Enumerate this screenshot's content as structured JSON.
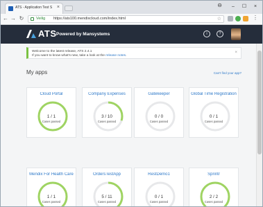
{
  "browser": {
    "tab_title": "ATS - Application Test S",
    "secure_label": "Veilig",
    "url": "https://ats100.mendixcloud.com/index.html"
  },
  "header": {
    "logo_text": "ATS",
    "logo_sub": "Powered by Mansystems"
  },
  "notice": {
    "line1": "Welcome to the latest release, ATS 2.4.1",
    "line2_prefix": "If you want to know what's new, take a look at the ",
    "line2_link": "release notes",
    "line2_suffix": "."
  },
  "main": {
    "title": "My apps",
    "cant_find": "Can't find your app?"
  },
  "apps": [
    {
      "name": "Cloud Portal",
      "count": "1 / 1",
      "sub": "Cases passed",
      "progress": 1.0
    },
    {
      "name": "Company Expenses",
      "count": "3 / 10",
      "sub": "Cases passed",
      "progress": 0.3
    },
    {
      "name": "Gatekeeper",
      "count": "0 / 0",
      "sub": "Cases passed",
      "progress": 0
    },
    {
      "name": "Global Time Registration",
      "count": "0 / 1",
      "sub": "Cases passed",
      "progress": 0
    },
    {
      "name": "Mendix For Health Care",
      "count": "1 / 1",
      "sub": "Cases passed",
      "progress": 1.0
    },
    {
      "name": "OrdersTestApp",
      "count": "5 / 11",
      "sub": "Cases passed",
      "progress": 0.45
    },
    {
      "name": "RestDemo1",
      "count": "0 / 1",
      "sub": "Cases passed",
      "progress": 0
    },
    {
      "name": "Sprintr",
      "count": "2 / 2",
      "sub": "Cases passed",
      "progress": 1.0
    }
  ],
  "colors": {
    "ring_pass": "#9fd462",
    "ring_track": "#e7e8ea",
    "header_bg": "#252d3b",
    "link": "#2d78c8",
    "notice_accent": "#7ac142"
  },
  "icons": {
    "back": "←",
    "forward": "→",
    "reload": "↻",
    "close": "×",
    "minimize": "–",
    "maximize": "☐",
    "user": "⊖",
    "star": "☆",
    "info": "i",
    "help": "?"
  }
}
